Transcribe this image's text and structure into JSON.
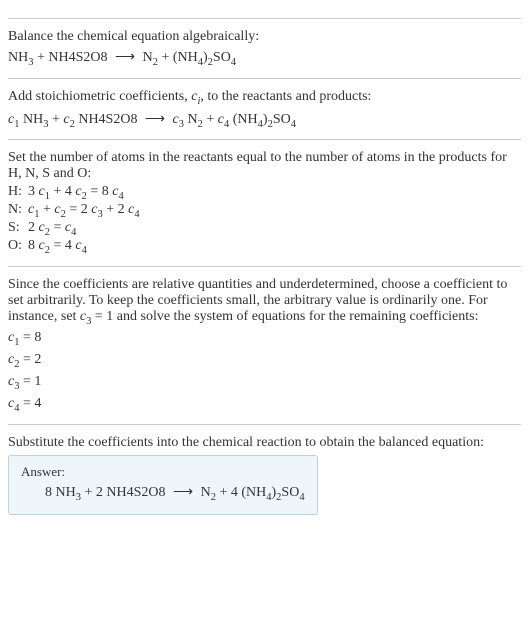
{
  "sec1": {
    "title": "Balance the chemical equation algebraically:",
    "lhs1": "NH",
    "lhs1sub": "3",
    "plus1": " + NH4S2O8 ",
    "arrow": "⟶",
    "rhs1": " N",
    "rhs1sub": "2",
    "plus2": " + (NH",
    "rhs2sub": "4",
    "rhs2": ")",
    "rhs3sub": "2",
    "rhs3": "SO",
    "rhs4sub": "4"
  },
  "sec2": {
    "title_a": "Add stoichiometric coefficients, ",
    "ci": "c",
    "ci_sub": "i",
    "title_b": ", to the reactants and products:",
    "c1": "c",
    "c1sub": "1",
    "sp1": " NH",
    "sp1sub": "3",
    "plus1": " + ",
    "c2": "c",
    "c2sub": "2",
    "sp2": " NH4S2O8 ",
    "arrow": "⟶",
    "c3": " c",
    "c3sub": "3",
    "sp3": " N",
    "sp3sub": "2",
    "plus2": " + ",
    "c4": "c",
    "c4sub": "4",
    "sp4a": " (NH",
    "sp4asub": "4",
    "sp4b": ")",
    "sp4bsub": "2",
    "sp4c": "SO",
    "sp4csub": "4"
  },
  "sec3": {
    "title": "Set the number of atoms in the reactants equal to the number of atoms in the products for H, N, S and O:",
    "rows": [
      {
        "label": "H:",
        "c1a": "3 ",
        "v1": "c",
        "s1": "1",
        "mid1": " + 4 ",
        "v2": "c",
        "s2": "2",
        "eq": " = 8 ",
        "v3": "c",
        "s3": "4"
      },
      {
        "label": "N:",
        "c1a": "",
        "v1": "c",
        "s1": "1",
        "mid1": " + ",
        "v2": "c",
        "s2": "2",
        "eq": " = 2 ",
        "v3": "c",
        "s3": "3",
        "mid2": " + 2 ",
        "v4": "c",
        "s4": "4"
      },
      {
        "label": "S:",
        "c1a": "2 ",
        "v1": "c",
        "s1": "2",
        "mid1": "",
        "v2": "",
        "s2": "",
        "eq": " = ",
        "v3": "c",
        "s3": "4"
      },
      {
        "label": "O:",
        "c1a": "8 ",
        "v1": "c",
        "s1": "2",
        "mid1": "",
        "v2": "",
        "s2": "",
        "eq": " = 4 ",
        "v3": "c",
        "s3": "4"
      }
    ]
  },
  "sec4": {
    "p1a": "Since the coefficients are relative quantities and underdetermined, choose a coefficient to set arbitrarily. To keep the coefficients small, the arbitrary value is ordinarily one. For instance, set ",
    "cv": "c",
    "cs": "3",
    "p1b": " = 1 and solve the system of equations for the remaining coefficients:",
    "lines": [
      {
        "v": "c",
        "s": "1",
        "eq": " = 8"
      },
      {
        "v": "c",
        "s": "2",
        "eq": " = 2"
      },
      {
        "v": "c",
        "s": "3",
        "eq": " = 1"
      },
      {
        "v": "c",
        "s": "4",
        "eq": " = 4"
      }
    ]
  },
  "sec5": {
    "title": "Substitute the coefficients into the chemical reaction to obtain the balanced equation:",
    "answer_label": "Answer:",
    "a1": "8 NH",
    "a1s": "3",
    "ap1": " + 2 NH4S2O8 ",
    "arrow": "⟶",
    "a2": " N",
    "a2s": "2",
    "ap2": " + 4 (NH",
    "a3s": "4",
    "a3": ")",
    "a4s": "2",
    "a4": "SO",
    "a5s": "4"
  }
}
